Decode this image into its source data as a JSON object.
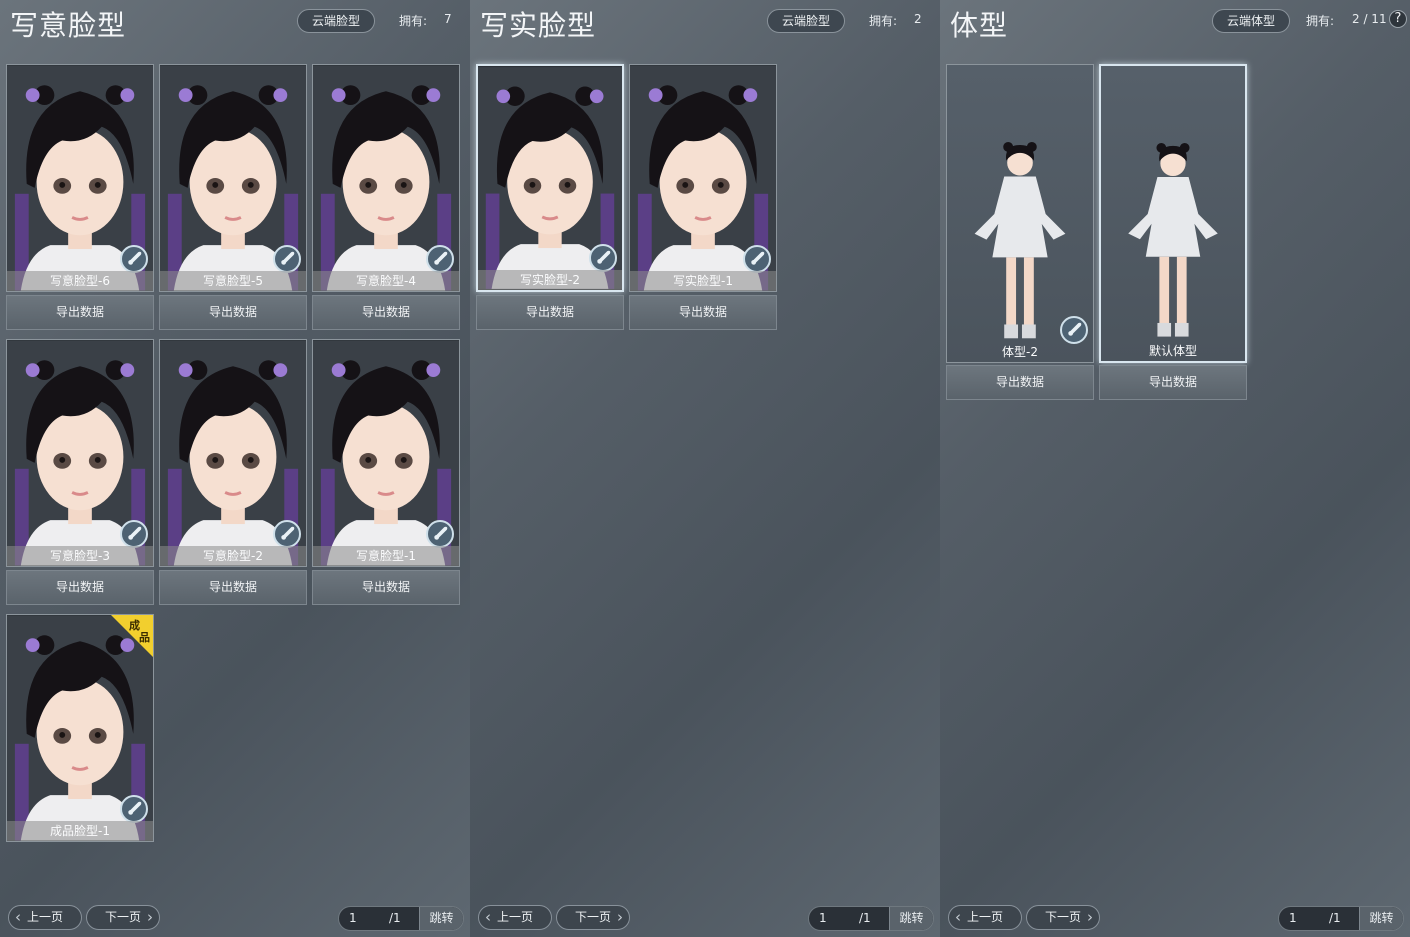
{
  "stylized_faces": {
    "title": "写意脸型",
    "cloud_button": "云端脸型",
    "own_label": "拥有:",
    "own_count": "7",
    "cards": [
      {
        "label": "写意脸型-6",
        "export": "导出数据"
      },
      {
        "label": "写意脸型-5",
        "export": "导出数据"
      },
      {
        "label": "写意脸型-4",
        "export": "导出数据"
      },
      {
        "label": "写意脸型-3",
        "export": "导出数据"
      },
      {
        "label": "写意脸型-2",
        "export": "导出数据"
      },
      {
        "label": "写意脸型-1",
        "export": "导出数据"
      },
      {
        "label": "成品脸型-1",
        "tag": [
          "成",
          "品"
        ]
      }
    ],
    "pager": {
      "prev": "上一页",
      "next": "下一页",
      "current": "1",
      "total": "/1",
      "jump": "跳转"
    }
  },
  "realistic_faces": {
    "title": "写实脸型",
    "cloud_button": "云端脸型",
    "own_label": "拥有:",
    "own_count": "2",
    "cards": [
      {
        "label": "写实脸型-2",
        "export": "导出数据"
      },
      {
        "label": "写实脸型-1",
        "export": "导出数据"
      }
    ],
    "pager": {
      "prev": "上一页",
      "next": "下一页",
      "current": "1",
      "total": "/1",
      "jump": "跳转"
    }
  },
  "body_types": {
    "title": "体型",
    "cloud_button": "云端体型",
    "own_label": "拥有:",
    "own_count": "2 / 11",
    "help": "?",
    "cards": [
      {
        "label": "体型-2",
        "export": "导出数据"
      },
      {
        "label": "默认体型",
        "export": "导出数据"
      }
    ],
    "pager": {
      "prev": "上一页",
      "next": "下一页",
      "current": "1",
      "total": "/1",
      "jump": "跳转"
    }
  },
  "colors": {
    "panel_bg": "#555e67",
    "card_border": "#8c959c",
    "selected_border": "#d9e6ef",
    "finished_tag": "#f2cf2e",
    "brush_badge": "#4d6273"
  }
}
